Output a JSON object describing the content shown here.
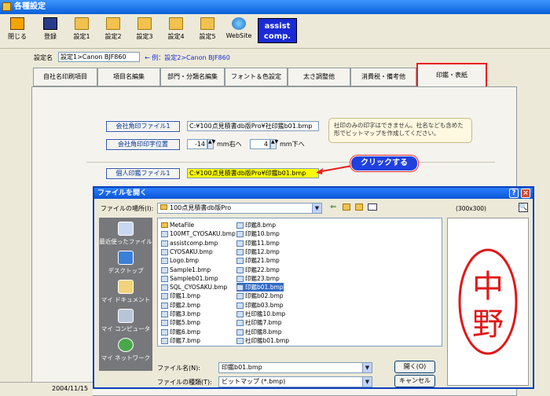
{
  "window": {
    "title": "各種設定"
  },
  "toolbar": {
    "buttons": [
      "閉じる",
      "登録",
      "設定1",
      "設定2",
      "設定3",
      "設定4",
      "設定5",
      "WebSite"
    ],
    "logo_line1": "assist",
    "logo_line2": "comp."
  },
  "setting": {
    "label": "設定名",
    "value": "設定1>Canon BJF860",
    "hint": "← 例：設定2>Canon BJF860"
  },
  "tabs": [
    "自社名印刷項目",
    "項目名編集",
    "部門・分類名編集",
    "フォント＆色設定",
    "太さ調整他",
    "消費税・備考他",
    "印鑑・表紙"
  ],
  "form": {
    "company_stamp_file_btn": "会社角印ファイル1",
    "company_stamp_file": "C:¥100点見積書db版Pro¥社印鑑b01.bmp",
    "company_stamp_pos_btn": "会社角印印字位置",
    "pos_right_value": "-14",
    "pos_right_unit": "mm右へ",
    "pos_down_value": "4",
    "pos_down_unit": "mm下へ",
    "note": "社印のみの印字はできません。社名なども含めた形でビットマップを作成してください。",
    "personal_stamp_btn": "個人印鑑ファイル1",
    "personal_stamp_file": "C:¥100点見積書db版Pro¥印鑑b01.bmp"
  },
  "callout": "クリックする",
  "dialog": {
    "title": "ファイルを開く",
    "location_label": "ファイルの場所(I):",
    "location_value": "100点見積書db版Pro",
    "preview_size": "(300x300)",
    "places": [
      "最近使ったファイル",
      "デスクトップ",
      "マイ ドキュメント",
      "マイ コンピュータ",
      "マイ ネットワーク"
    ],
    "files_col1": [
      "MetaFile",
      "100MT_CYOSAKU.bmp",
      "assistcomp.bmp",
      "CYOSAKU.bmp",
      "Logo.bmp",
      "Sample1.bmp",
      "Sampleb01.bmp",
      "SQL_CYOSAKU.bmp",
      "印鑑1.bmp",
      "印鑑2.bmp",
      "印鑑3.bmp",
      "印鑑5.bmp",
      "印鑑6.bmp",
      "印鑑7.bmp"
    ],
    "files_col2": [
      "印鑑8.bmp",
      "印鑑10.bmp",
      "印鑑11.bmp",
      "印鑑12.bmp",
      "印鑑21.bmp",
      "印鑑22.bmp",
      "印鑑23.bmp",
      "印鑑b01.bmp",
      "印鑑b02.bmp",
      "印鑑b03.bmp",
      "社印鑑10.bmp",
      "社印鑑7.bmp",
      "社印鑑8.bmp",
      "社印鑑b01.bmp"
    ],
    "selected_file": "印鑑b01.bmp",
    "filename_label": "ファイル名(N):",
    "filename_value": "印鑑b01.bmp",
    "filetype_label": "ファイルの種類(T):",
    "filetype_value": "ビットマップ (*.bmp)",
    "open_btn": "開く(O)",
    "cancel_btn": "キャンセル",
    "preview_chars": [
      "中",
      "野"
    ]
  },
  "status": {
    "date": "2004/11/15"
  },
  "colors": {
    "accent_red": "#e82020",
    "title_blue": "#0a5fd8",
    "stamp_red": "#e01818"
  }
}
